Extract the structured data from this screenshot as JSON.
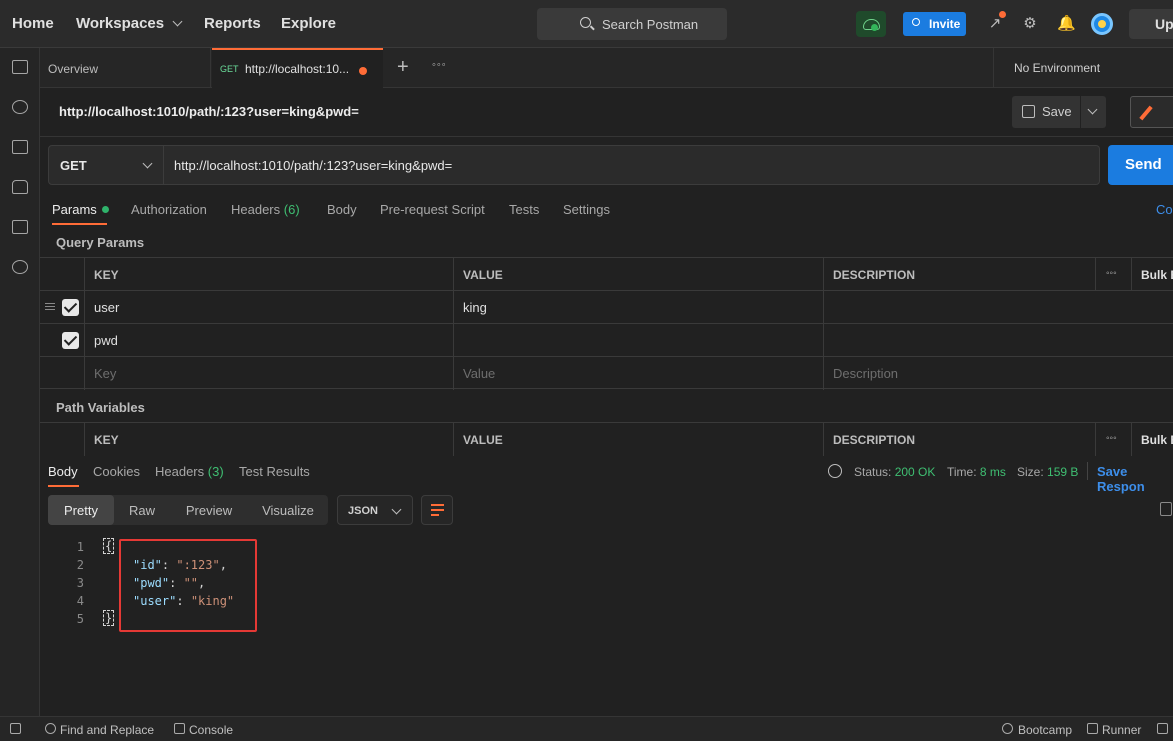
{
  "nav": {
    "home": "Home",
    "workspaces": "Workspaces",
    "reports": "Reports",
    "explore": "Explore",
    "search_placeholder": "Search Postman",
    "invite": "Invite",
    "upgrade": "Up"
  },
  "tabs": {
    "overview": "Overview",
    "active_method": "GET",
    "active_url": "http://localhost:10...",
    "environment": "No Environment"
  },
  "request": {
    "title": "http://localhost:1010/path/:123?user=king&pwd=",
    "save": "Save",
    "method": "GET",
    "url": "http://localhost:1010/path/:123?user=king&pwd=",
    "send": "Send"
  },
  "request_tabs": {
    "params": "Params",
    "authorization": "Authorization",
    "headers": "Headers",
    "headers_count": "(6)",
    "body": "Body",
    "prerequest": "Pre-request Script",
    "tests": "Tests",
    "settings": "Settings",
    "cookies_link": "Co"
  },
  "query_params": {
    "label": "Query Params",
    "headers": {
      "key": "KEY",
      "value": "VALUE",
      "description": "DESCRIPTION",
      "bulk": "Bulk E"
    },
    "rows": [
      {
        "key": "user",
        "value": "king"
      },
      {
        "key": "pwd",
        "value": ""
      }
    ],
    "placeholders": {
      "key": "Key",
      "value": "Value",
      "description": "Description"
    }
  },
  "path_variables": {
    "label": "Path Variables",
    "headers": {
      "key": "KEY",
      "value": "VALUE",
      "description": "DESCRIPTION",
      "bulk": "Bulk E"
    }
  },
  "response": {
    "tabs": {
      "body": "Body",
      "cookies": "Cookies",
      "headers": "Headers",
      "headers_count": "(3)",
      "test_results": "Test Results"
    },
    "status_label": "Status:",
    "status_value": "200 OK",
    "time_label": "Time:",
    "time_value": "8 ms",
    "size_label": "Size:",
    "size_value": "159 B",
    "save_response": "Save Respon",
    "formats": {
      "pretty": "Pretty",
      "raw": "Raw",
      "preview": "Preview",
      "visualize": "Visualize"
    },
    "language": "JSON",
    "lines": [
      {
        "num": "1"
      },
      {
        "num": "2",
        "key": "\"id\"",
        "sep": ": ",
        "val": "\":123\"",
        "end": ","
      },
      {
        "num": "3",
        "key": "\"pwd\"",
        "sep": ": ",
        "val": "\"\"",
        "end": ","
      },
      {
        "num": "4",
        "key": "\"user\"",
        "sep": ": ",
        "val": "\"king\"",
        "end": ""
      },
      {
        "num": "5"
      }
    ],
    "open_brace": "{",
    "close_brace": "}"
  },
  "bottom": {
    "find_replace": "Find and Replace",
    "console": "Console",
    "bootcamp": "Bootcamp",
    "runner": "Runner"
  },
  "colors": {
    "accent": "#ff6c37",
    "primary": "#1b7ce0",
    "success": "#3fbf72",
    "highlight_box": "#e53935"
  }
}
